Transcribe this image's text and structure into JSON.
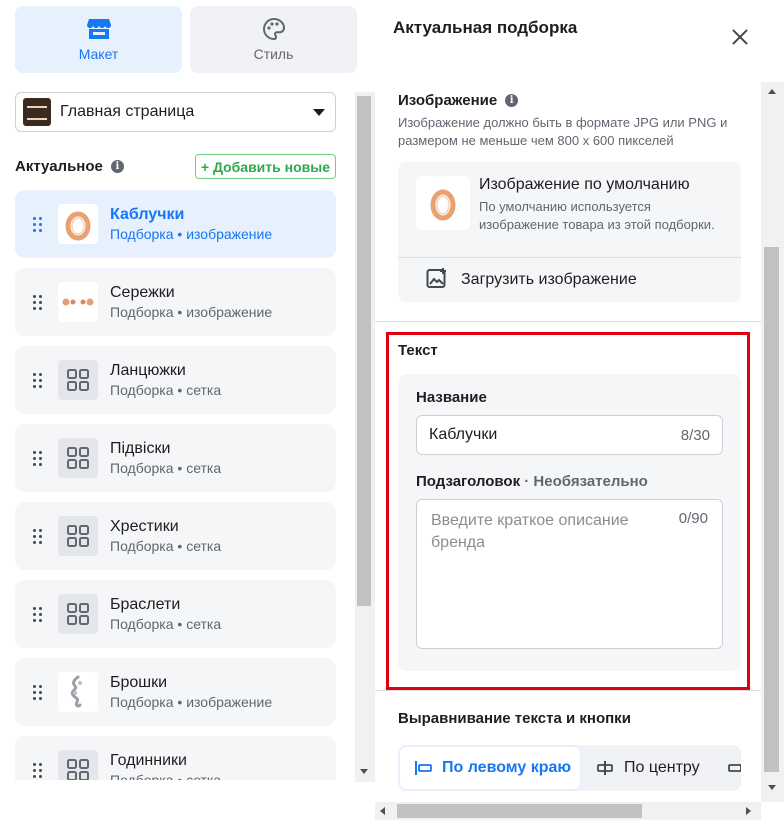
{
  "top_tabs": [
    {
      "label": "Макет",
      "icon": "store-icon",
      "active": true
    },
    {
      "label": "Стиль",
      "icon": "palette-icon",
      "active": false
    }
  ],
  "page_selector": {
    "value": "Главная страница"
  },
  "featured": {
    "title": "Актуальное",
    "add_button": "+ Добавить новые",
    "items": [
      {
        "name": "Каблучки",
        "sub": "Подборка • изображение",
        "thumb": "ring-image",
        "active": true
      },
      {
        "name": "Сережки",
        "sub": "Подборка • изображение",
        "thumb": "earrings-image",
        "active": false
      },
      {
        "name": "Ланцюжки",
        "sub": "Подборка • сетка",
        "thumb": "grid-icon",
        "active": false
      },
      {
        "name": "Підвіски",
        "sub": "Подборка • сетка",
        "thumb": "grid-icon",
        "active": false
      },
      {
        "name": "Хрестики",
        "sub": "Подборка • сетка",
        "thumb": "grid-icon",
        "active": false
      },
      {
        "name": "Браслети",
        "sub": "Подборка • сетка",
        "thumb": "grid-icon",
        "active": false
      },
      {
        "name": "Брошки",
        "sub": "Подборка • изображение",
        "thumb": "brooch-image",
        "active": false
      },
      {
        "name": "Годинники",
        "sub": "Подборка • сетка",
        "thumb": "grid-icon",
        "active": false
      }
    ]
  },
  "panel": {
    "title": "Актуальная подборка",
    "image_section": {
      "title": "Изображение",
      "description": "Изображение должно быть в формате JPG или PNG и размером не меньше чем 800 x 600 пикселей",
      "default_title": "Изображение по умолчанию",
      "default_desc": "По умолчанию используется изображение товара из этой подборки.",
      "upload_label": "Загрузить изображение"
    },
    "text_section": {
      "title": "Текст",
      "name_label": "Название",
      "name_value": "Каблучки",
      "name_counter": "8/30",
      "subtitle_label": "Подзаголовок",
      "subtitle_optional": " · Необязательно",
      "subtitle_placeholder": "Введите краткое описание бренда",
      "subtitle_counter": "0/90"
    },
    "align_section": {
      "title": "Выравнивание текста и кнопки",
      "options": [
        {
          "label": "По левому краю",
          "active": true
        },
        {
          "label": "По центру",
          "active": false
        }
      ]
    }
  },
  "colors": {
    "accent": "#1877f2",
    "highlight": "#e00010",
    "add_green": "#2fa84f"
  }
}
